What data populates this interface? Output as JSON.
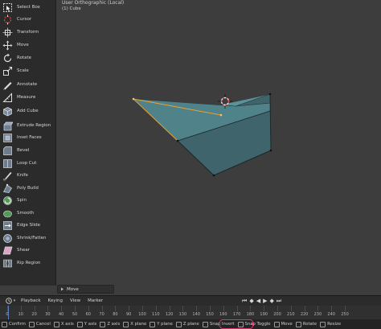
{
  "colors": {
    "accent": "#5680c2",
    "highlight": "#e0306f",
    "mesh": "#4c7d86",
    "selected_edge": "#f0a030"
  },
  "toolbar": {
    "tools": [
      {
        "label": "Select Box",
        "icon": "select-box-icon"
      },
      {
        "label": "Cursor",
        "icon": "cursor-icon"
      },
      {
        "label": "Transform",
        "icon": "transform-icon"
      },
      {
        "label": "Move",
        "icon": "move-icon"
      },
      {
        "label": "Rotate",
        "icon": "rotate-icon"
      },
      {
        "label": "Scale",
        "icon": "scale-icon"
      },
      {
        "label": "Annotate",
        "icon": "annotate-icon"
      },
      {
        "label": "Measure",
        "icon": "measure-icon"
      },
      {
        "label": "Add Cube",
        "icon": "add-cube-icon"
      },
      {
        "label": "Extrude Region",
        "icon": "extrude-region-icon"
      },
      {
        "label": "Inset Faces",
        "icon": "inset-faces-icon"
      },
      {
        "label": "Bevel",
        "icon": "bevel-icon"
      },
      {
        "label": "Loop Cut",
        "icon": "loop-cut-icon"
      },
      {
        "label": "Knife",
        "icon": "knife-icon"
      },
      {
        "label": "Poly Build",
        "icon": "poly-build-icon"
      },
      {
        "label": "Spin",
        "icon": "spin-icon"
      },
      {
        "label": "Smooth",
        "icon": "smooth-icon"
      },
      {
        "label": "Edge Slide",
        "icon": "edge-slide-icon"
      },
      {
        "label": "Shrink/Fatten",
        "icon": "shrink-fatten-icon"
      },
      {
        "label": "Shear",
        "icon": "shear-icon"
      },
      {
        "label": "Rip Region",
        "icon": "rip-region-icon"
      }
    ]
  },
  "viewport": {
    "title": "User Orthographic (Local)",
    "subtitle": "(1) Cube"
  },
  "operator_panel": {
    "label": "Move"
  },
  "timeline": {
    "menus": [
      "Playback",
      "Keying",
      "View",
      "Marker"
    ],
    "ticks": [
      "0",
      "10",
      "20",
      "30",
      "40",
      "50",
      "60",
      "70",
      "80",
      "90",
      "100",
      "110",
      "120",
      "130",
      "140",
      "150",
      "160",
      "170",
      "180",
      "190",
      "200",
      "210",
      "220",
      "230",
      "240",
      "250"
    ]
  },
  "statusbar": {
    "items": [
      "Confirm",
      "Cancel",
      "X axis",
      "Y axis",
      "Z axis",
      "X plane",
      "Y plane",
      "Z plane",
      "Snap Invert",
      "Snap Toggle",
      "Move",
      "Rotate",
      "Resize"
    ]
  }
}
